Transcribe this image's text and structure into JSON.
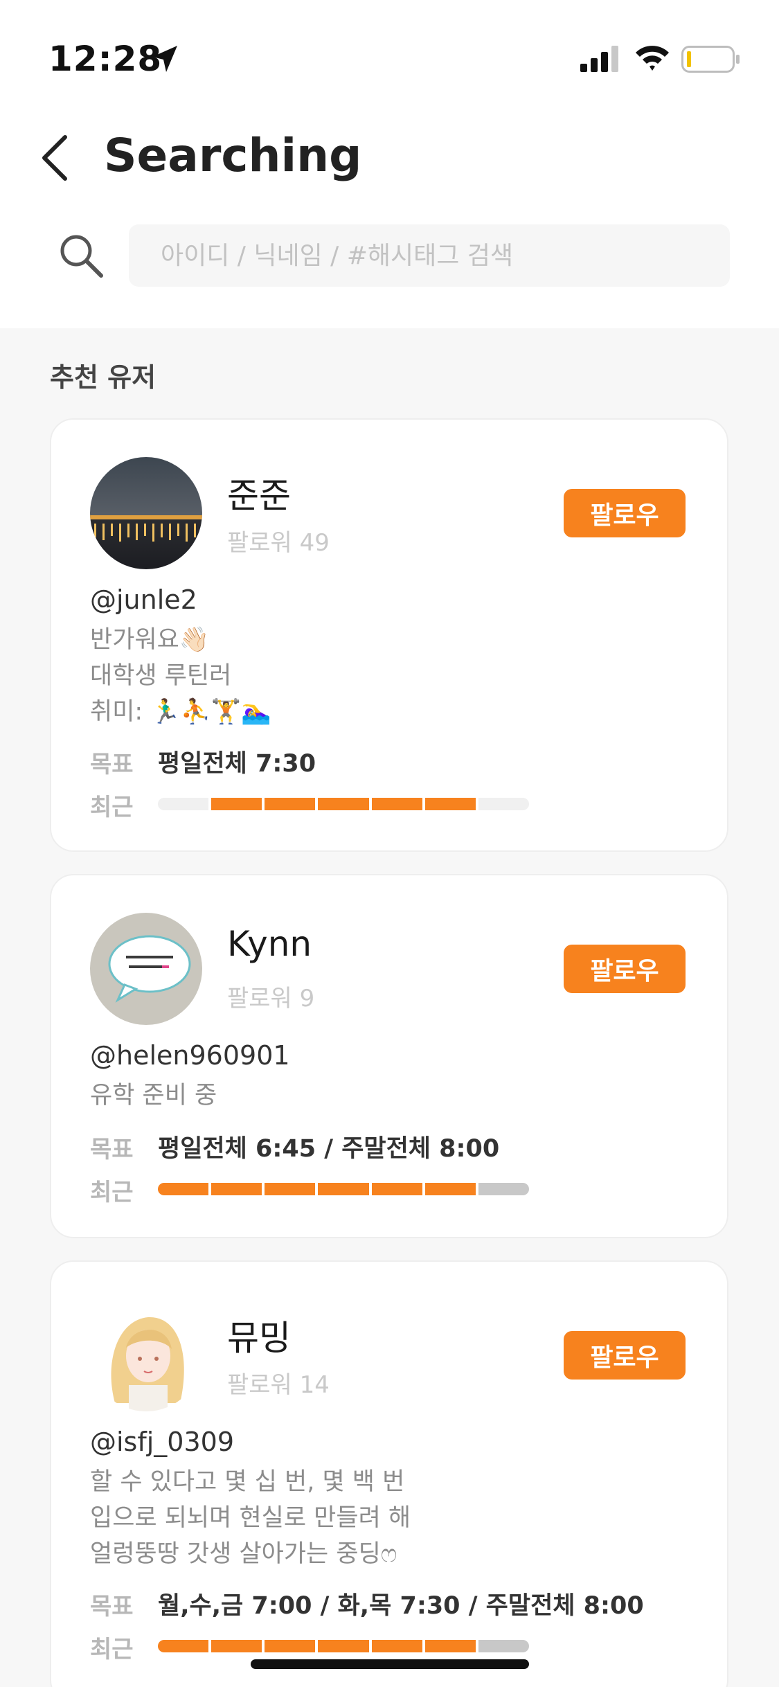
{
  "status_bar": {
    "time": "12:28",
    "icons": [
      "location-arrow-icon",
      "signal-icon",
      "wifi-icon",
      "battery-icon"
    ]
  },
  "header": {
    "title": "Searching",
    "back_icon": "chevron-left-icon"
  },
  "search": {
    "placeholder": "아이디 / 닉네임 / #해시태그 검색",
    "value": "",
    "icon": "search-icon"
  },
  "section": {
    "title": "추천 유저"
  },
  "labels": {
    "follow": "팔로우",
    "goal": "목표",
    "recent": "최근"
  },
  "colors": {
    "accent": "#f7821e",
    "recent_miss": "#c8c8c8",
    "recent_empty": "#f0f0f0"
  },
  "users": [
    {
      "name": "준준",
      "followers": "팔로워 49",
      "handle": "@junle2",
      "bio": [
        "반가워요👋🏻",
        "대학생 루틴러",
        "취미: 🏃‍♂️⛹️🏋️🏊‍♀️"
      ],
      "goal": "평일전체 7:30",
      "recent": [
        "empty",
        "done",
        "done",
        "done",
        "done",
        "done",
        "empty"
      ],
      "avatar": "avatar-night-bridge"
    },
    {
      "name": "Kynn",
      "followers": "팔로워 9",
      "handle": "@helen960901",
      "bio": [
        "유학 준비 중"
      ],
      "goal": "평일전체 6:45 / 주말전체 8:00",
      "recent": [
        "done",
        "done",
        "done",
        "done",
        "done",
        "done",
        "miss"
      ],
      "avatar": "avatar-speech-bubble-sticker"
    },
    {
      "name": "뮤밍",
      "followers": "팔로워 14",
      "handle": "@isfj_0309",
      "bio": [
        "할 수 있다고 몇 십 번, 몇 백 번",
        "입으로 되뇌며 현실로 만들려 해",
        "얼렁뚱땅 갓생 살아가는 중딩ෆ"
      ],
      "goal": "월,수,금 7:00 / 화,목 7:30 / 주말전체 8:00",
      "recent": [
        "done",
        "done",
        "done",
        "done",
        "done",
        "done",
        "miss"
      ],
      "avatar": "avatar-anime-girl"
    }
  ]
}
